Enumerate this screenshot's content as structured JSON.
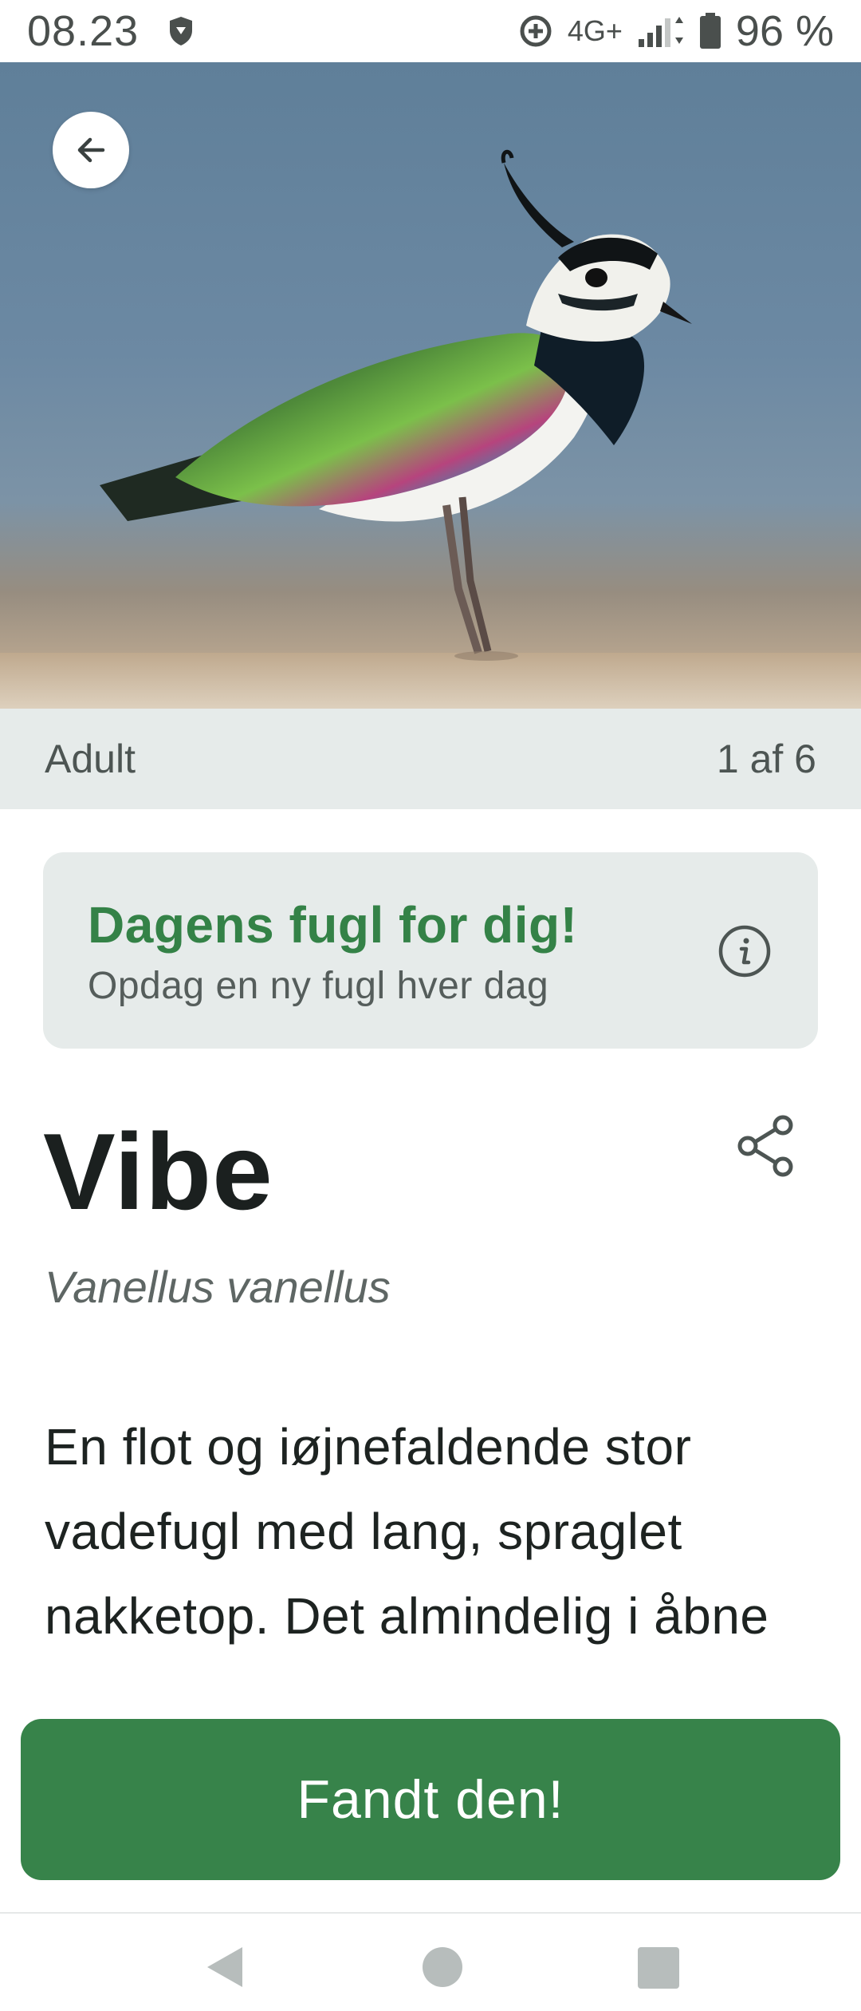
{
  "status_bar": {
    "time": "08.23",
    "network": "4G+",
    "battery": "96 %",
    "icons": [
      "shield-icon",
      "data-saver-icon",
      "signal-icon",
      "battery-icon"
    ]
  },
  "hero": {
    "image_subject": "lapwing-bird",
    "caption_label": "Adult",
    "counter": "1 af 6"
  },
  "daily_bird": {
    "title": "Dagens fugl for dig!",
    "subtitle": "Opdag en ny fugl hver dag",
    "icon": "info-icon"
  },
  "bird": {
    "name": "Vibe",
    "latin_name": "Vanellus vanellus",
    "description": "En flot og iøjnefaldende stor vadefugl med lang, spraglet nakketop. Det almindelig i åbne"
  },
  "actions": {
    "found_button": "Fandt den!",
    "share_icon": "share-icon",
    "back_icon": "arrow-left-icon"
  },
  "colors": {
    "accent_green": "#37834a",
    "title_green": "#348247",
    "card_bg": "#e6ebea"
  }
}
